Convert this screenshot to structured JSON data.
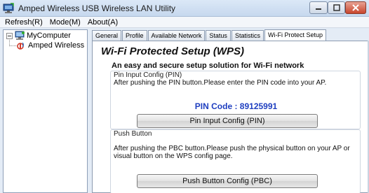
{
  "window": {
    "title": "Amped Wireless USB Wireless LAN Utility",
    "icons": {
      "app": "network-monitor-icon",
      "minimize": "minimize-icon",
      "maximize": "maximize-icon",
      "close": "close-icon"
    }
  },
  "menubar": {
    "items": [
      {
        "label": "Refresh(R)"
      },
      {
        "label": "Mode(M)"
      },
      {
        "label": "About(A)"
      }
    ]
  },
  "tree": {
    "root": {
      "label": "MyComputer",
      "icon": "computer-icon",
      "expander": "−"
    },
    "child": {
      "label": "Amped Wireless",
      "icon": "wireless-adapter-icon"
    }
  },
  "tabs": [
    {
      "label": "General"
    },
    {
      "label": "Profile"
    },
    {
      "label": "Available Network"
    },
    {
      "label": "Status"
    },
    {
      "label": "Statistics"
    },
    {
      "label": "Wi-Fi Protect Setup",
      "active": true
    }
  ],
  "wps": {
    "title": "Wi-Fi Protected Setup (WPS)",
    "subtitle": "An easy and secure setup solution for Wi-Fi network",
    "pin_group": {
      "title": "Pin Input Config (PIN)",
      "description": "After pushing the PIN button.Please enter the PIN code into your AP.",
      "pin_code": "PIN Code :  89125991",
      "button_label": "Pin Input Config (PIN)"
    },
    "pbc_group": {
      "title": "Push Button",
      "description": "After pushing the PBC button.Please push the physical button on your AP or visual button on the WPS config page.",
      "button_label": "Push Button Config (PBC)"
    }
  },
  "colors": {
    "pin_code": "#1f3fc0",
    "frame": "#dfe9f5",
    "close_button": "#c8452c"
  }
}
